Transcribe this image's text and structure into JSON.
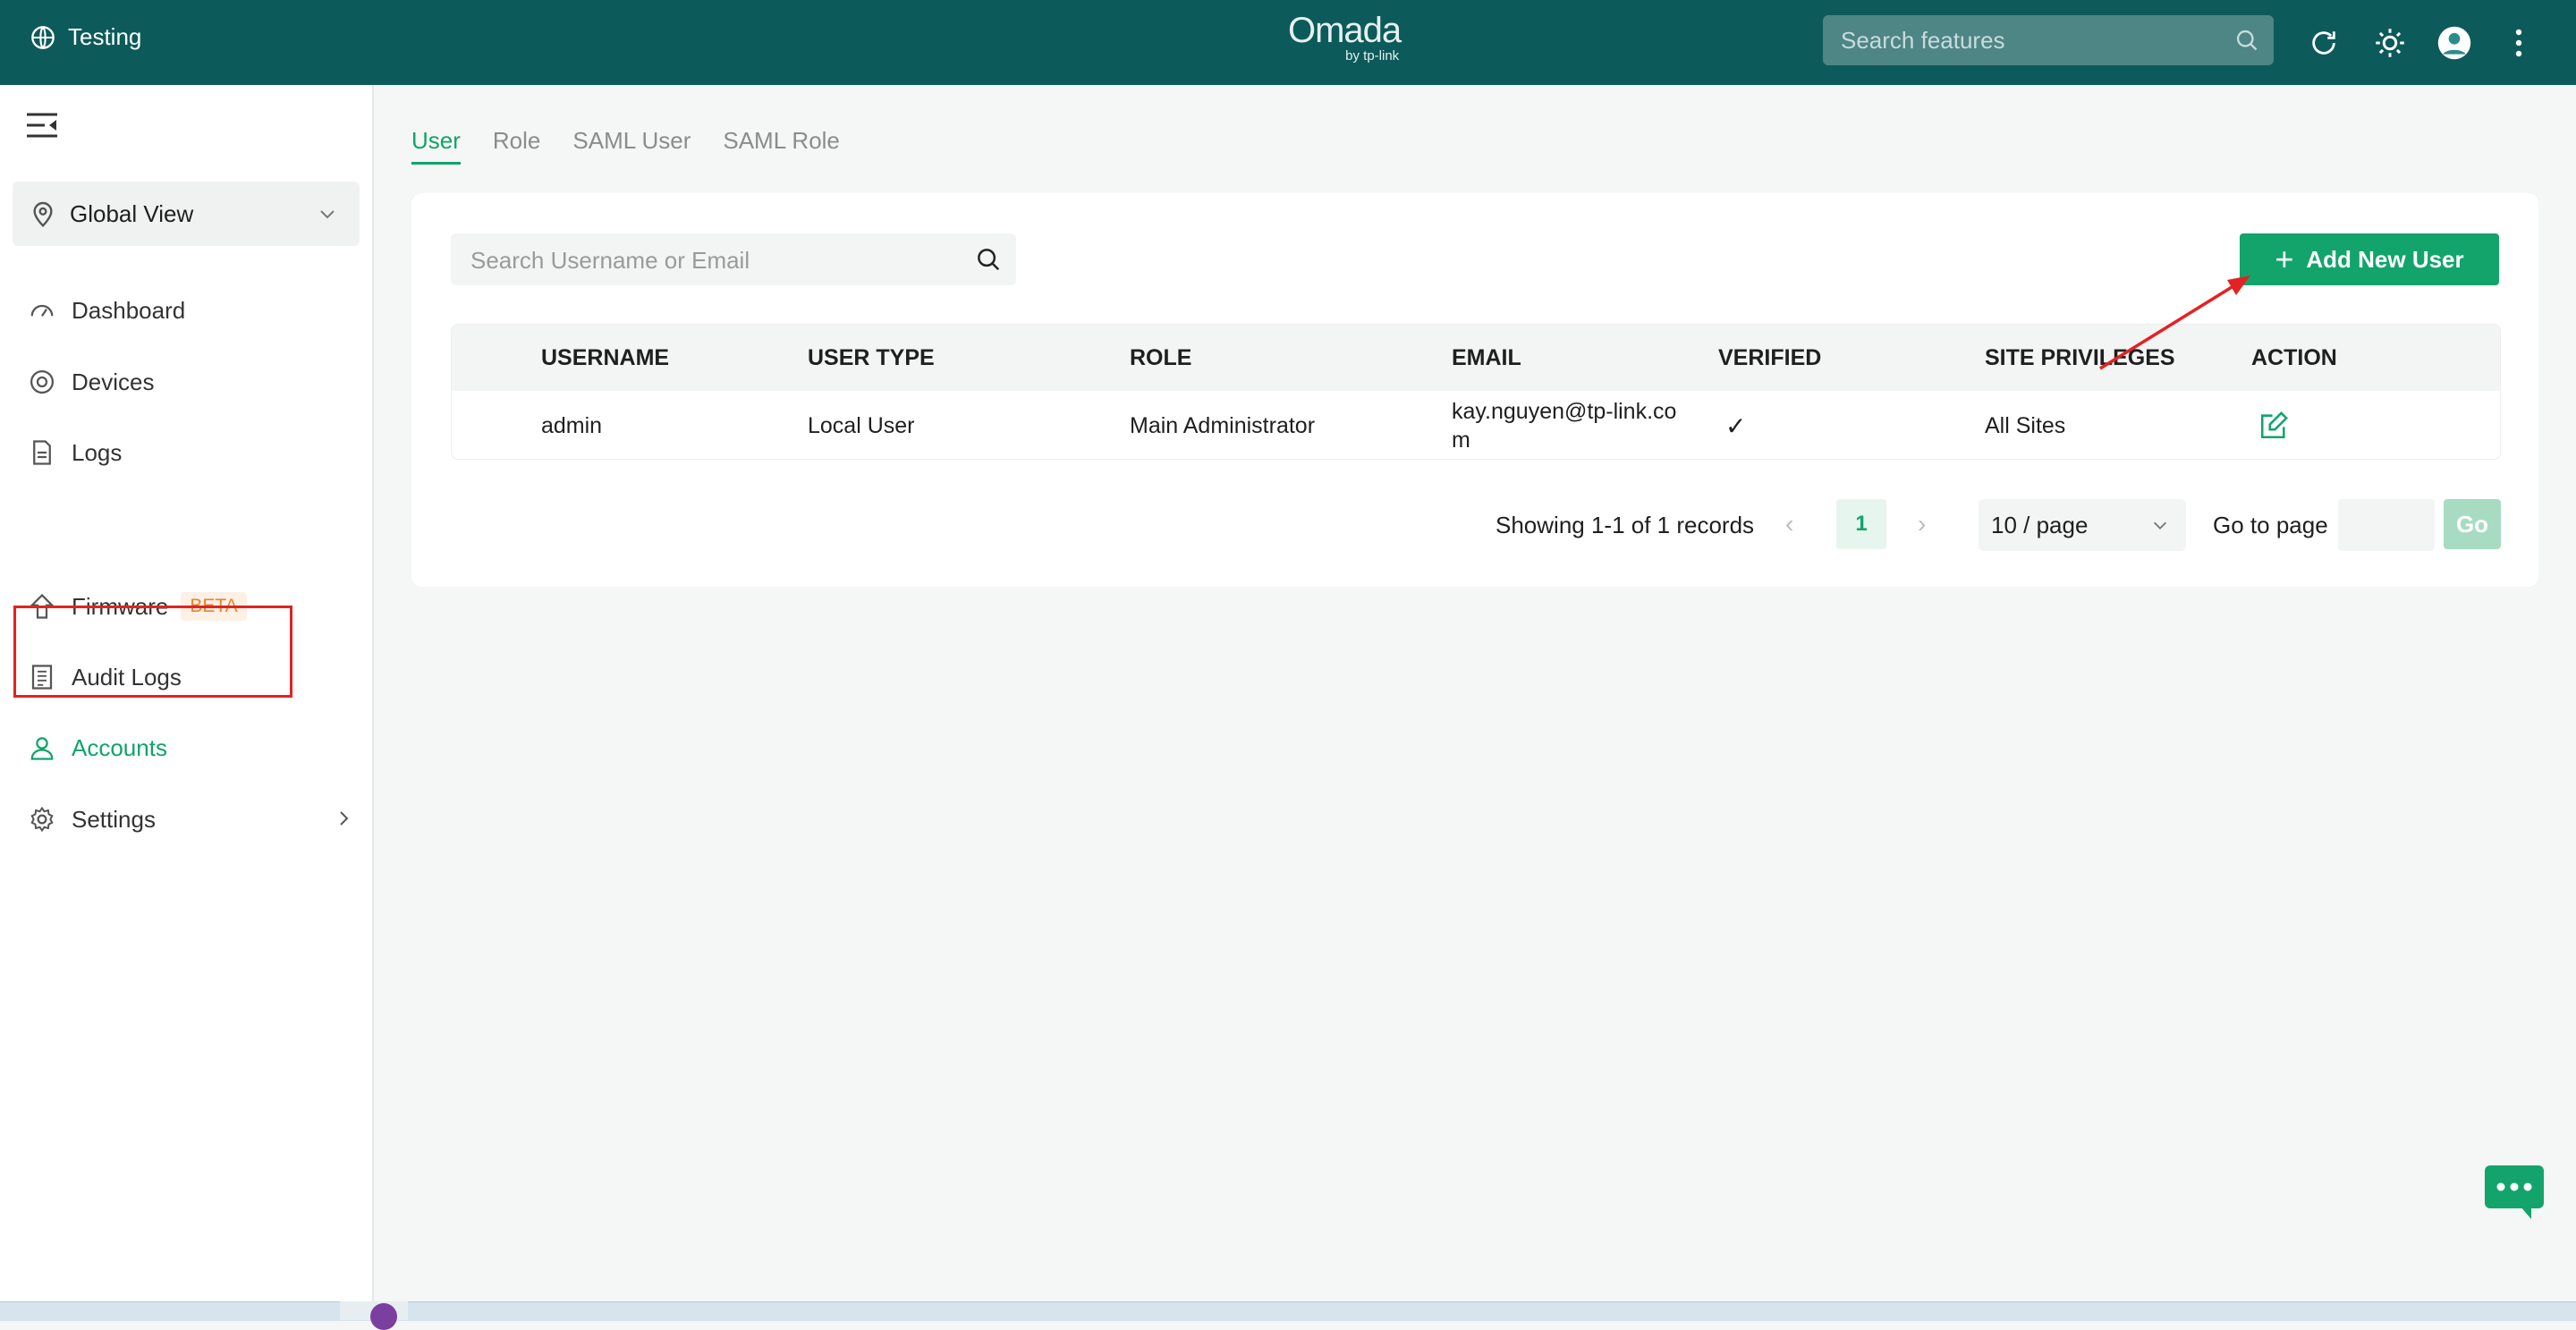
{
  "topbar": {
    "site_name": "Testing",
    "brand_name": "Omada",
    "brand_sub": "by tp-link",
    "search_placeholder": "Search features"
  },
  "sidebar": {
    "global_view": "Global View",
    "items": [
      {
        "label": "Dashboard"
      },
      {
        "label": "Devices"
      },
      {
        "label": "Logs"
      },
      {
        "label": "Firmware",
        "badge": "BETA"
      },
      {
        "label": "Audit Logs"
      },
      {
        "label": "Accounts"
      },
      {
        "label": "Settings"
      }
    ]
  },
  "tabs": [
    {
      "label": "User"
    },
    {
      "label": "Role"
    },
    {
      "label": "SAML User"
    },
    {
      "label": "SAML Role"
    }
  ],
  "content": {
    "search_placeholder": "Search Username or Email",
    "add_button": "Add New User",
    "columns": [
      "USERNAME",
      "USER TYPE",
      "ROLE",
      "EMAIL",
      "VERIFIED",
      "SITE PRIVILEGES",
      "ACTION"
    ],
    "rows": [
      {
        "username": "admin",
        "user_type": "Local User",
        "role": "Main Administrator",
        "email": "kay.nguyen@tp-link.com",
        "verified": "✓",
        "site_privileges": "All Sites"
      }
    ],
    "pagination": {
      "info": "Showing 1-1 of 1 records",
      "current_page": "1",
      "per_page": "10 / page",
      "goto_label": "Go to page",
      "go_button": "Go"
    }
  },
  "colors": {
    "topbar": "#0d5a5a",
    "accent": "#12a46b",
    "annotation": "#e32222"
  }
}
